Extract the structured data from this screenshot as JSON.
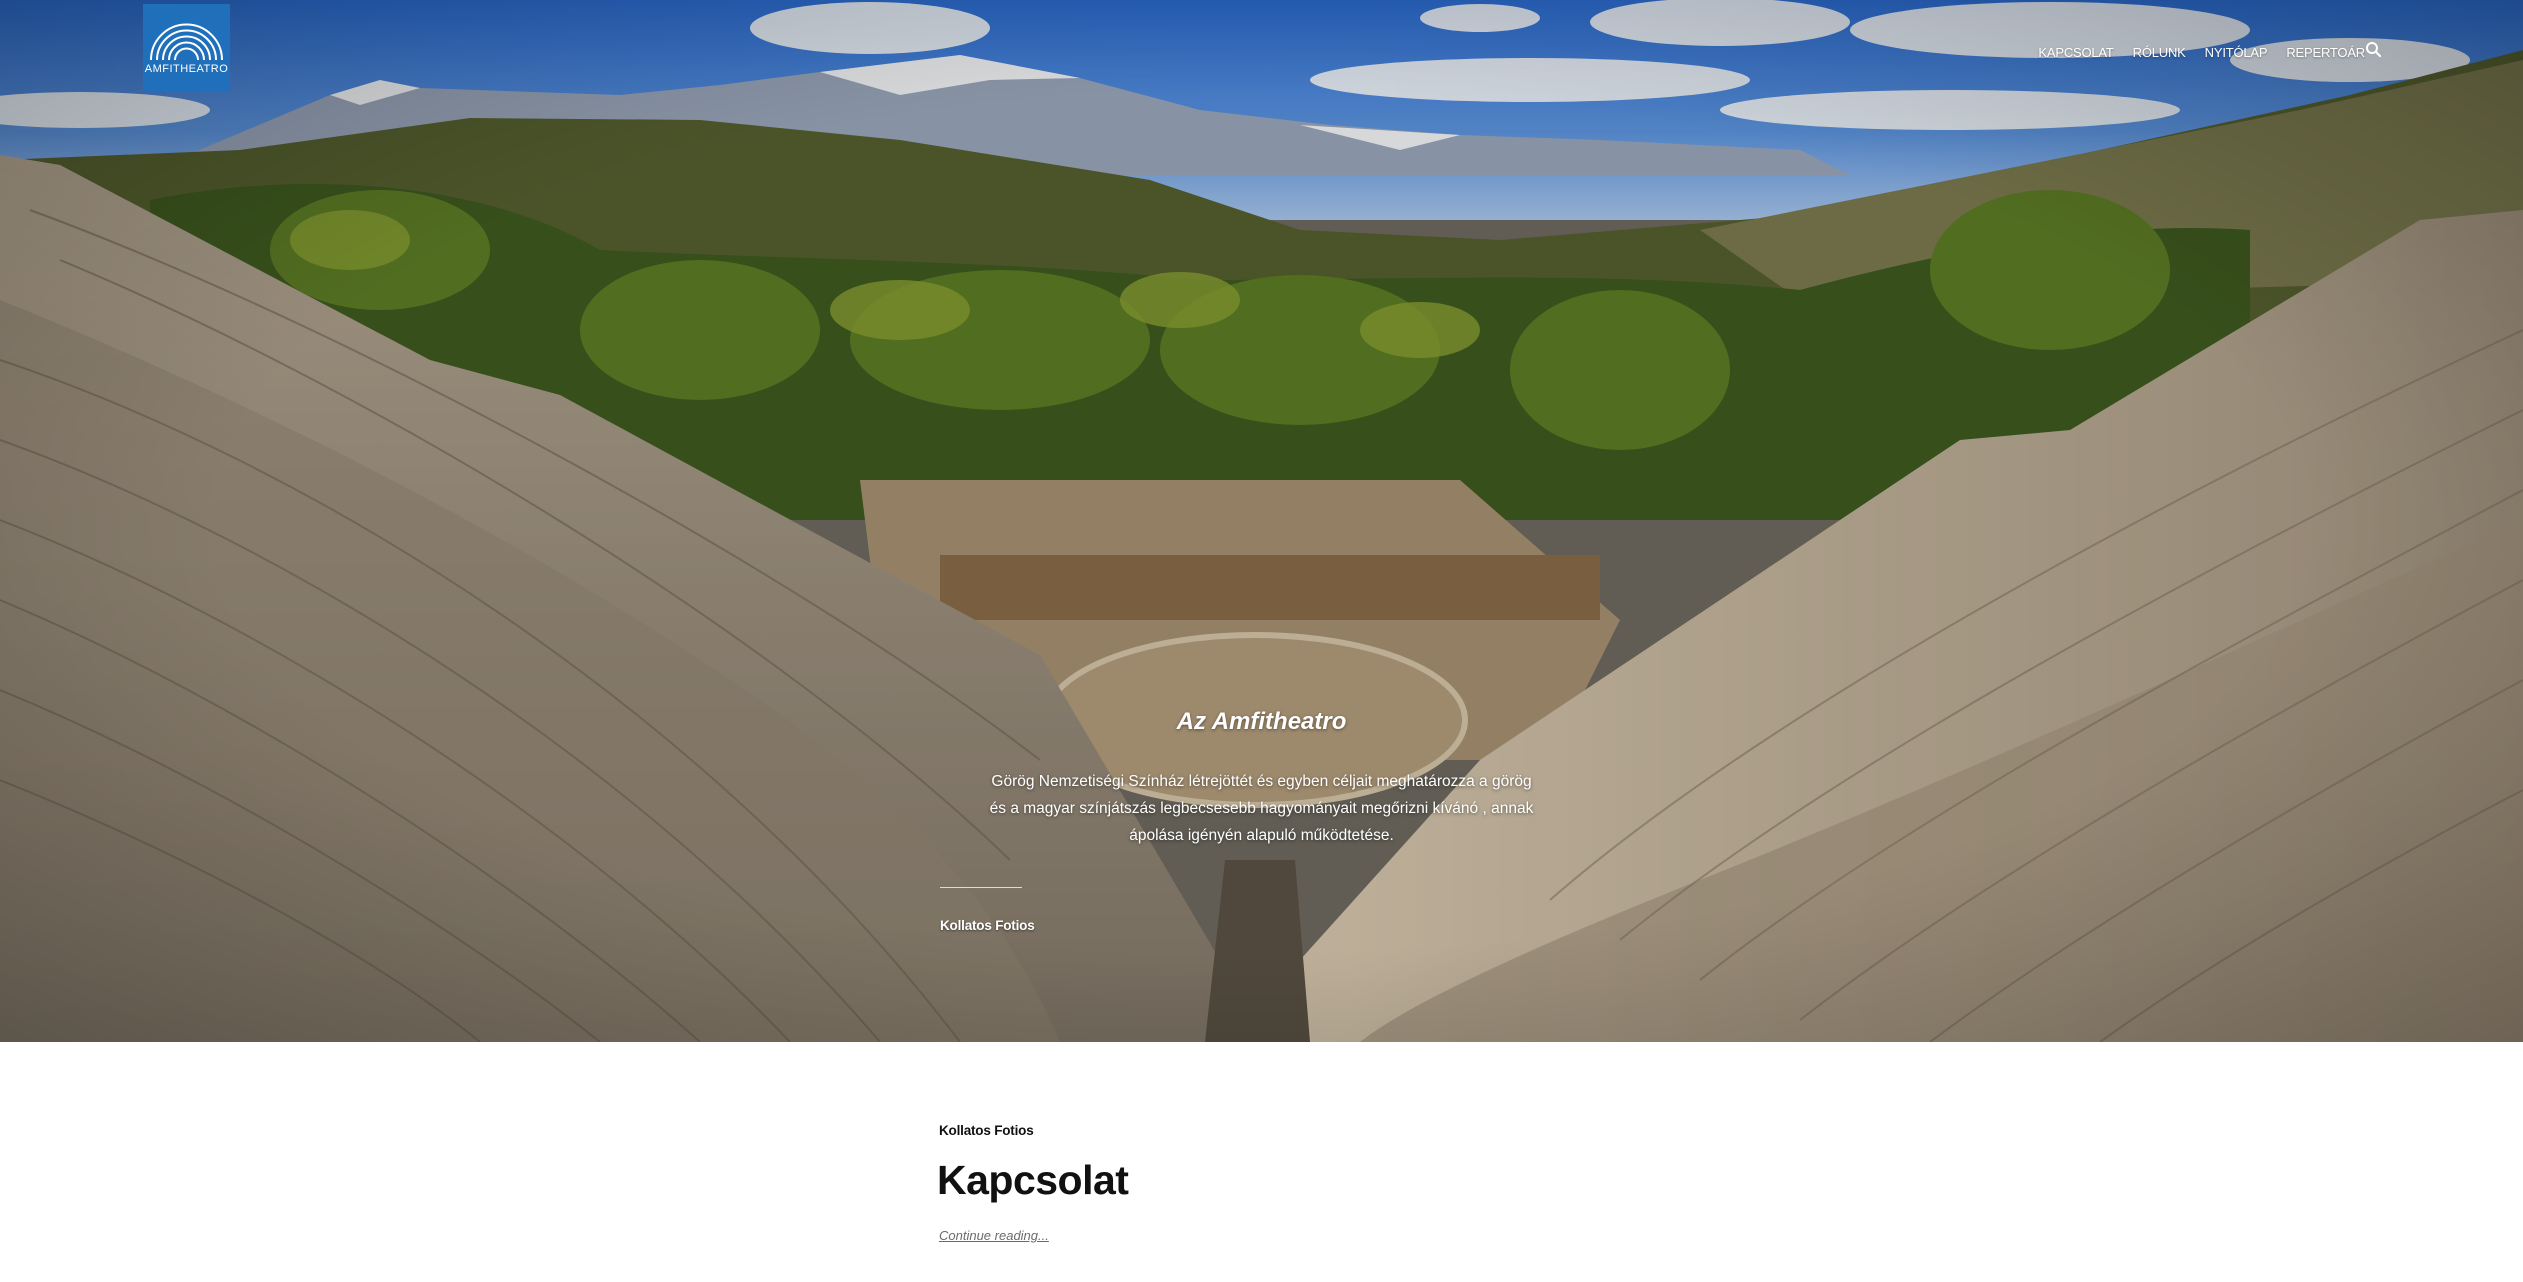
{
  "header": {
    "logo_text": "AMFITHEATRO",
    "nav": [
      {
        "label": "KAPCSOLAT"
      },
      {
        "label": "RÓLUNK"
      },
      {
        "label": "NYITÓLAP"
      },
      {
        "label": "REPERTOÁR"
      }
    ],
    "search_icon": "search-icon"
  },
  "hero": {
    "title": "Az Amfitheatro",
    "description": "Görög Nemzetiségi Színház létrejöttét és egyben céljait meghatározza a görög és a magyar színjátszás legbecsesebb hagyományait megőrizni kívánó , annak ápolása igényén alapuló működtetése.",
    "author": "Kollatos Fotios"
  },
  "post": {
    "author": "Kollatos Fotios",
    "title": "Kapcsolat",
    "continue_label": "Continue reading..."
  },
  "colors": {
    "logo_bg": "#1f6fba",
    "text_dark": "#111111",
    "link_muted": "#6b6b6b"
  }
}
